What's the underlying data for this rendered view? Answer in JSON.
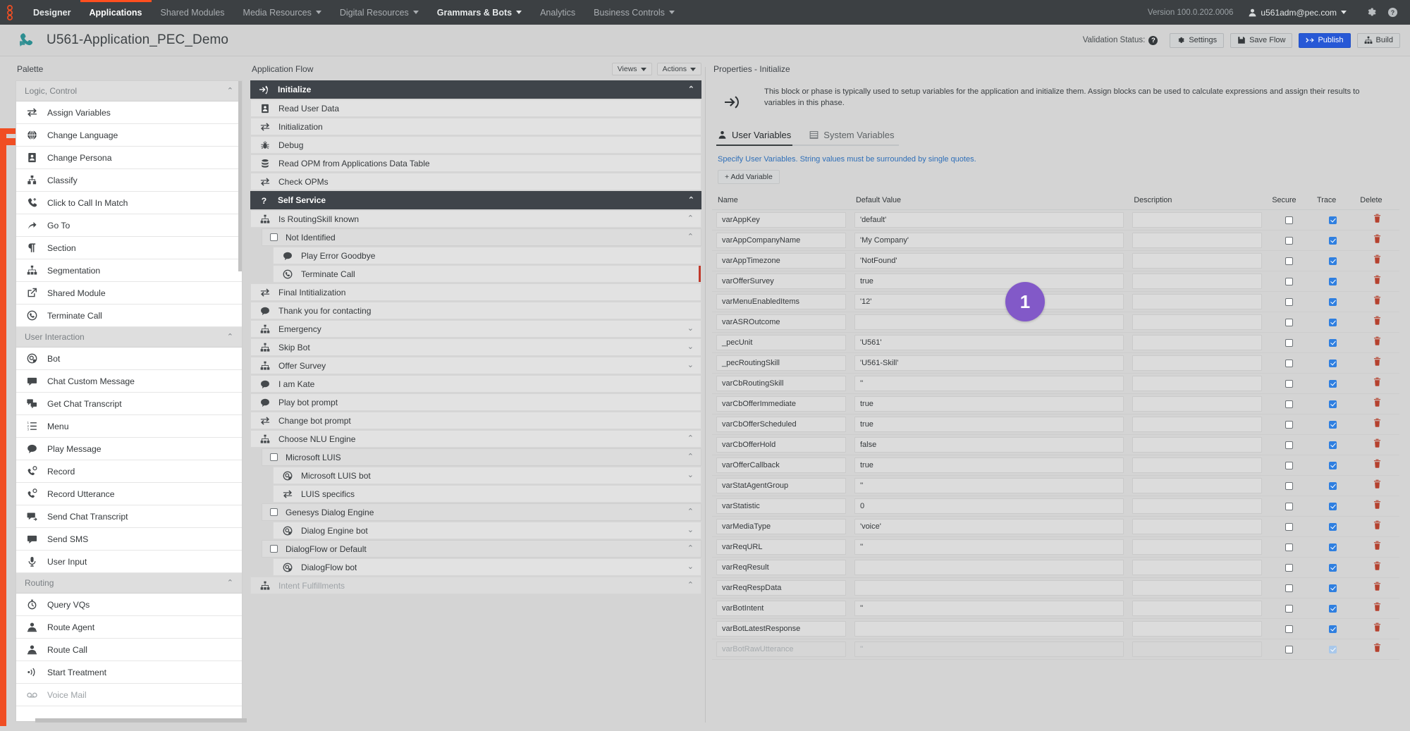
{
  "topnav": {
    "logo_icon": "genesys-logo-icon",
    "items": [
      {
        "label": "Designer",
        "active": false,
        "strong": true,
        "dropdown": false
      },
      {
        "label": "Applications",
        "active": true,
        "strong": true,
        "dropdown": false
      },
      {
        "label": "Shared Modules",
        "active": false,
        "strong": false,
        "dropdown": false
      },
      {
        "label": "Media Resources",
        "active": false,
        "strong": false,
        "dropdown": true
      },
      {
        "label": "Digital Resources",
        "active": false,
        "strong": false,
        "dropdown": true
      },
      {
        "label": "Grammars & Bots",
        "active": false,
        "strong": true,
        "dropdown": true
      },
      {
        "label": "Analytics",
        "active": false,
        "strong": false,
        "dropdown": false
      },
      {
        "label": "Business Controls",
        "active": false,
        "strong": false,
        "dropdown": true
      }
    ],
    "version": "Version 100.0.202.0006",
    "user": "u561adm@pec.com",
    "settings_icon": "gear-icon",
    "help_icon": "help-circle-icon"
  },
  "titlebar": {
    "app_icon": "phone-chat-icon",
    "app_title": "U561-Application_PEC_Demo",
    "validation_label": "Validation Status:",
    "buttons": [
      {
        "label": "Settings",
        "icon": "gear-icon",
        "primary": false
      },
      {
        "label": "Save Flow",
        "icon": "save-icon",
        "primary": false
      },
      {
        "label": "Publish",
        "icon": "publish-icon",
        "primary": true
      },
      {
        "label": "Build",
        "icon": "build-icon",
        "primary": false
      }
    ]
  },
  "palette": {
    "title": "Palette",
    "groups": [
      {
        "name": "Logic, Control",
        "collapsed": false,
        "items": [
          {
            "label": "Assign Variables",
            "icon": "assign-variables-icon"
          },
          {
            "label": "Change Language",
            "icon": "globe-icon"
          },
          {
            "label": "Change Persona",
            "icon": "persona-icon"
          },
          {
            "label": "Classify",
            "icon": "classify-icon"
          },
          {
            "label": "Click to Call In Match",
            "icon": "click-to-call-icon"
          },
          {
            "label": "Go To",
            "icon": "goto-arrow-icon"
          },
          {
            "label": "Section",
            "icon": "pilcrow-icon"
          },
          {
            "label": "Segmentation",
            "icon": "segmentation-icon"
          },
          {
            "label": "Shared Module",
            "icon": "external-link-icon"
          },
          {
            "label": "Terminate Call",
            "icon": "terminate-call-icon"
          }
        ]
      },
      {
        "name": "User Interaction",
        "collapsed": false,
        "items": [
          {
            "label": "Bot",
            "icon": "bot-icon"
          },
          {
            "label": "Chat Custom Message",
            "icon": "chat-bubble-icon"
          },
          {
            "label": "Get Chat Transcript",
            "icon": "get-chat-transcript-icon"
          },
          {
            "label": "Menu",
            "icon": "menu-list-icon"
          },
          {
            "label": "Play Message",
            "icon": "speech-bubble-icon"
          },
          {
            "label": "Record",
            "icon": "record-phone-icon"
          },
          {
            "label": "Record Utterance",
            "icon": "record-phone-icon"
          },
          {
            "label": "Send Chat Transcript",
            "icon": "send-chat-transcript-icon"
          },
          {
            "label": "Send SMS",
            "icon": "sms-icon"
          },
          {
            "label": "User Input",
            "icon": "microphone-icon"
          }
        ]
      },
      {
        "name": "Routing",
        "collapsed": false,
        "items": [
          {
            "label": "Query VQs",
            "icon": "stopwatch-icon"
          },
          {
            "label": "Route Agent",
            "icon": "agent-icon"
          },
          {
            "label": "Route Call",
            "icon": "agent-icon"
          },
          {
            "label": "Start Treatment",
            "icon": "treatment-wave-icon"
          },
          {
            "label": "Voice Mail",
            "icon": "voicemail-icon",
            "dim": true
          }
        ]
      }
    ]
  },
  "flow": {
    "title": "Application Flow",
    "views_label": "Views",
    "actions_label": "Actions",
    "nodes": [
      {
        "label": "Initialize",
        "kind": "phase",
        "indent": 0,
        "icon": "initialize-icon",
        "chevron": "up"
      },
      {
        "label": "Read User Data",
        "kind": "node",
        "indent": 1,
        "icon": "persona-icon"
      },
      {
        "label": "Initialization",
        "kind": "node",
        "indent": 1,
        "icon": "assign-variables-icon"
      },
      {
        "label": "Debug",
        "kind": "node",
        "indent": 1,
        "icon": "bug-icon"
      },
      {
        "label": "Read OPM from Applications Data Table",
        "kind": "node",
        "indent": 1,
        "icon": "database-icon"
      },
      {
        "label": "Check OPMs",
        "kind": "node",
        "indent": 1,
        "icon": "assign-variables-icon"
      },
      {
        "label": "Self Service",
        "kind": "phase",
        "indent": 0,
        "icon": "question-icon",
        "chevron": "up"
      },
      {
        "label": "Is RoutingSkill known",
        "kind": "node",
        "indent": 1,
        "icon": "segmentation-icon",
        "chevron": "up"
      },
      {
        "label": "Not Identified",
        "kind": "cond",
        "indent": 2,
        "icon": "checkbox-icon",
        "chevron": "up"
      },
      {
        "label": "Play Error Goodbye",
        "kind": "node",
        "indent": 3,
        "icon": "speech-bubble-icon"
      },
      {
        "label": "Terminate Call",
        "kind": "node",
        "indent": 3,
        "icon": "terminate-call-icon",
        "selected": true
      },
      {
        "label": "Final Intitialization",
        "kind": "node",
        "indent": 1,
        "icon": "assign-variables-icon"
      },
      {
        "label": "Thank you for contacting",
        "kind": "node",
        "indent": 1,
        "icon": "speech-bubble-icon"
      },
      {
        "label": "Emergency",
        "kind": "node",
        "indent": 1,
        "icon": "segmentation-icon",
        "chevron": "down"
      },
      {
        "label": "Skip Bot",
        "kind": "node",
        "indent": 1,
        "icon": "segmentation-icon",
        "chevron": "down"
      },
      {
        "label": "Offer Survey",
        "kind": "node",
        "indent": 1,
        "icon": "segmentation-icon",
        "chevron": "down"
      },
      {
        "label": "I am Kate",
        "kind": "node",
        "indent": 1,
        "icon": "speech-bubble-icon"
      },
      {
        "label": "Play bot prompt",
        "kind": "node",
        "indent": 1,
        "icon": "speech-bubble-icon"
      },
      {
        "label": "Change bot prompt",
        "kind": "node",
        "indent": 1,
        "icon": "assign-variables-icon"
      },
      {
        "label": "Choose NLU Engine",
        "kind": "node",
        "indent": 1,
        "icon": "segmentation-icon",
        "chevron": "up"
      },
      {
        "label": "Microsoft LUIS",
        "kind": "cond",
        "indent": 2,
        "icon": "checkbox-icon",
        "chevron": "up"
      },
      {
        "label": "Microsoft LUIS bot",
        "kind": "node",
        "indent": 3,
        "icon": "bot-icon",
        "chevron": "down"
      },
      {
        "label": "LUIS specifics",
        "kind": "node",
        "indent": 3,
        "icon": "assign-variables-icon"
      },
      {
        "label": "Genesys Dialog Engine",
        "kind": "cond",
        "indent": 2,
        "icon": "checkbox-icon",
        "chevron": "up"
      },
      {
        "label": "Dialog Engine bot",
        "kind": "node",
        "indent": 3,
        "icon": "bot-icon",
        "chevron": "down"
      },
      {
        "label": "DialogFlow or Default",
        "kind": "cond",
        "indent": 2,
        "icon": "checkbox-icon",
        "chevron": "up"
      },
      {
        "label": "DialogFlow bot",
        "kind": "node",
        "indent": 3,
        "icon": "bot-icon",
        "chevron": "down"
      },
      {
        "label": "Intent Fulfillments",
        "kind": "node",
        "indent": 1,
        "icon": "segmentation-icon",
        "chevron": "up",
        "dim": true
      }
    ]
  },
  "properties": {
    "title": "Properties - Initialize",
    "block_icon": "initialize-icon",
    "description": "This block or phase is typically used to setup variables for the application and initialize them. Assign blocks can be used to calculate expressions and assign their results to variables in this phase.",
    "tabs": [
      {
        "label": "User Variables",
        "icon": "user-icon",
        "active": true
      },
      {
        "label": "System Variables",
        "icon": "table-icon",
        "active": false
      }
    ],
    "hint": "Specify User Variables. String values must be surrounded by single quotes.",
    "add_variable_label": "+ Add Variable",
    "table": {
      "headers": [
        "Name",
        "Default Value",
        "Description",
        "Secure",
        "Trace",
        "Delete"
      ],
      "rows": [
        {
          "name": "varAppKey",
          "value": "'default'",
          "description": "",
          "secure": false,
          "trace": true
        },
        {
          "name": "varAppCompanyName",
          "value": "'My Company'",
          "description": "",
          "secure": false,
          "trace": true
        },
        {
          "name": "varAppTimezone",
          "value": "'NotFound'",
          "description": "",
          "secure": false,
          "trace": true
        },
        {
          "name": "varOfferSurvey",
          "value": "true",
          "description": "",
          "secure": false,
          "trace": true
        },
        {
          "name": "varMenuEnabledItems",
          "value": "'12'",
          "description": "",
          "secure": false,
          "trace": true
        },
        {
          "name": "varASROutcome",
          "value": "",
          "description": "",
          "secure": false,
          "trace": true
        },
        {
          "name": "_pecUnit",
          "value": "'U561'",
          "description": "",
          "secure": false,
          "trace": true
        },
        {
          "name": "_pecRoutingSkill",
          "value": "'U561-Skill'",
          "description": "",
          "secure": false,
          "trace": true
        },
        {
          "name": "varCbRoutingSkill",
          "value": "''",
          "description": "",
          "secure": false,
          "trace": true
        },
        {
          "name": "varCbOfferImmediate",
          "value": "true",
          "description": "",
          "secure": false,
          "trace": true
        },
        {
          "name": "varCbOfferScheduled",
          "value": "true",
          "description": "",
          "secure": false,
          "trace": true
        },
        {
          "name": "varCbOfferHold",
          "value": "false",
          "description": "",
          "secure": false,
          "trace": true
        },
        {
          "name": "varOfferCallback",
          "value": "true",
          "description": "",
          "secure": false,
          "trace": true
        },
        {
          "name": "varStatAgentGroup",
          "value": "''",
          "description": "",
          "secure": false,
          "trace": true
        },
        {
          "name": "varStatistic",
          "value": "0",
          "description": "",
          "secure": false,
          "trace": true
        },
        {
          "name": "varMediaType",
          "value": "'voice'",
          "description": "",
          "secure": false,
          "trace": true
        },
        {
          "name": "varReqURL",
          "value": "''",
          "description": "",
          "secure": false,
          "trace": true
        },
        {
          "name": "varReqResult",
          "value": "",
          "description": "",
          "secure": false,
          "trace": true
        },
        {
          "name": "varReqRespData",
          "value": "",
          "description": "",
          "secure": false,
          "trace": true
        },
        {
          "name": "varBotIntent",
          "value": "''",
          "description": "",
          "secure": false,
          "trace": true
        },
        {
          "name": "varBotLatestResponse",
          "value": "",
          "description": "",
          "secure": false,
          "trace": true
        },
        {
          "name": "varBotRawUtterance",
          "value": "''",
          "description": "",
          "secure": false,
          "trace": true,
          "dim": true
        }
      ]
    }
  },
  "annotation": {
    "step_badge": "1"
  },
  "colors": {
    "accent_orange": "#f04e23",
    "nav_dark": "#3c4043",
    "phase_dark": "#3f444a",
    "publish_blue": "#2758d6",
    "badge_purple": "#8259c8",
    "delete_red": "#b5412e",
    "checkbox_blue": "#2f7fe0",
    "link_blue": "#2f6fb8"
  }
}
